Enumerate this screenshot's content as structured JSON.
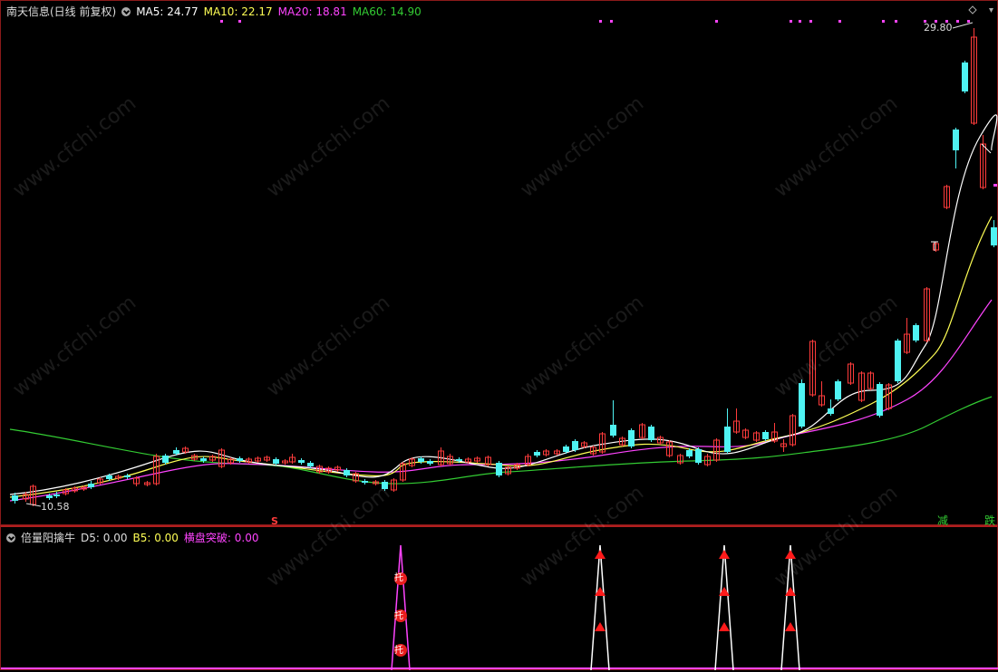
{
  "main": {
    "title": "南天信息(日线 前复权)",
    "ma5": "MA5: 24.77",
    "ma10": "MA10: 22.17",
    "ma20": "MA20: 18.81",
    "ma60": "MA60: 14.90",
    "high_label": "29.80",
    "low_label": "10.58",
    "signal_s": "S",
    "tag_reduce": "减",
    "tag_fall": "跌",
    "colors": {
      "ma5": "#ffffff",
      "ma10": "#ffff55",
      "ma20": "#ff44ff",
      "ma60": "#33cc33",
      "up": "#ff3b3b",
      "down": "#4ff3f3",
      "border": "#8b1a1a"
    }
  },
  "sub": {
    "title": "倍量阳擒牛",
    "d5": "D5: 0.00",
    "b5": "B5: 0.00",
    "hp": "横盘突破: 0.00",
    "marker_text": "托"
  },
  "watermark": "www.cfchi.com"
}
